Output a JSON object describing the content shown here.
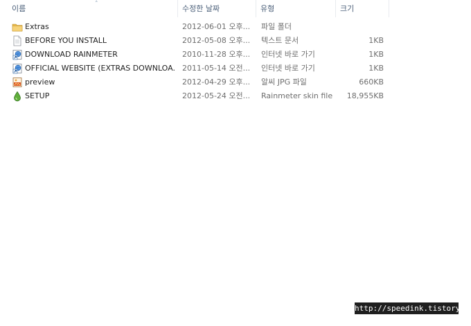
{
  "columns": {
    "name": "이름",
    "date": "수정한 날짜",
    "type": "유형",
    "size": "크기"
  },
  "files": [
    {
      "name": "Extras",
      "date": "2012-06-01 오후...",
      "type": "파일 폴더",
      "size": "",
      "icon": "folder-icon"
    },
    {
      "name": "BEFORE YOU INSTALL",
      "date": "2012-05-08 오후...",
      "type": "텍스트 문서",
      "size": "1KB",
      "icon": "text-document-icon"
    },
    {
      "name": "DOWNLOAD RAINMETER",
      "date": "2010-11-28 오후...",
      "type": "인터넷 바로 가기",
      "size": "1KB",
      "icon": "internet-shortcut-icon"
    },
    {
      "name": "OFFICIAL WEBSITE (EXTRAS DOWNLOA...",
      "date": "2011-05-14 오전...",
      "type": "인터넷 바로 가기",
      "size": "1KB",
      "icon": "internet-shortcut-icon"
    },
    {
      "name": "preview",
      "date": "2012-04-29 오후...",
      "type": "알씨 JPG 파일",
      "size": "660KB",
      "icon": "jpg-image-icon"
    },
    {
      "name": "SETUP",
      "date": "2012-05-24 오전...",
      "type": "Rainmeter skin file",
      "size": "18,955KB",
      "icon": "rainmeter-skin-icon"
    }
  ],
  "watermark": "http://speedink.tistory.com"
}
